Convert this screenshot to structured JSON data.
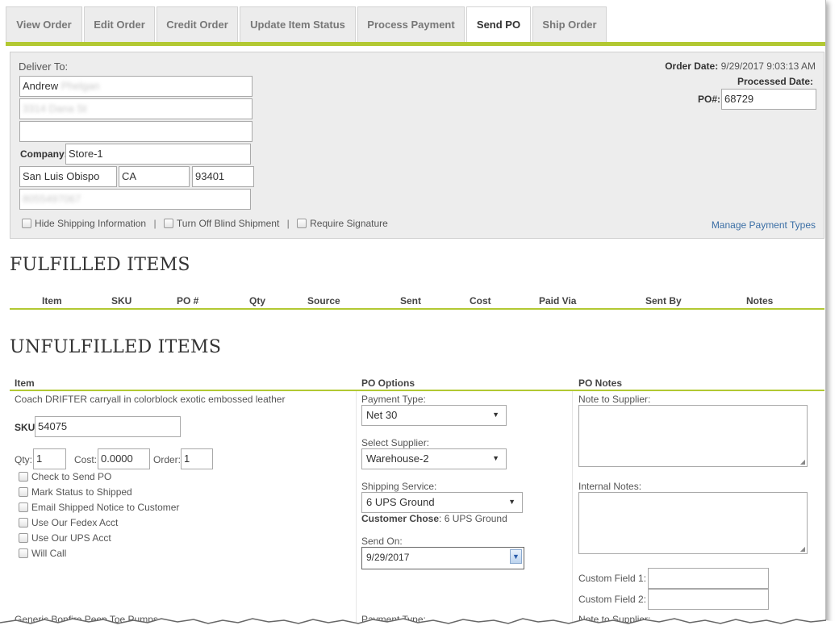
{
  "tabs": [
    {
      "label": "View Order"
    },
    {
      "label": "Edit Order"
    },
    {
      "label": "Credit Order"
    },
    {
      "label": "Update Item Status"
    },
    {
      "label": "Process Payment"
    },
    {
      "label": "Send PO"
    },
    {
      "label": "Ship Order"
    }
  ],
  "deliver": {
    "heading": "Deliver To:",
    "name": "Andrew",
    "name_redacted": "Phelgan",
    "address1_redacted": "3314 Dana St",
    "address2": "",
    "company_label": "Company:",
    "company": "Store-1",
    "city": "San Luis Obispo",
    "state": "CA",
    "zip": "93401",
    "phone_redacted": "8055497067",
    "checkboxes": {
      "hide_shipping": "Hide Shipping Information",
      "blind_shipment": "Turn Off Blind Shipment",
      "require_signature": "Require Signature"
    },
    "separator": "|",
    "order_date_label": "Order Date:",
    "order_date": "9/29/2017 9:03:13 AM",
    "processed_date_label": "Processed Date:",
    "po_label": "PO#:",
    "po_value": "68729",
    "manage_payment_types": "Manage Payment Types"
  },
  "fulfilled": {
    "title": "FULFILLED ITEMS",
    "columns": [
      "Item",
      "SKU",
      "PO #",
      "Qty",
      "Source",
      "Sent",
      "Cost",
      "Paid Via",
      "Sent By",
      "Notes"
    ]
  },
  "unfulfilled": {
    "title": "UNFULFILLED ITEMS",
    "columns": {
      "item": "Item",
      "po_options": "PO Options",
      "po_notes": "PO Notes"
    },
    "item": {
      "description": "Coach DRIFTER carryall in colorblock exotic embossed leather",
      "sku_label": "SKU:",
      "sku": "54075",
      "qty_label": "Qty:",
      "qty": "1",
      "cost_label": "Cost:",
      "cost": "0.0000",
      "order_label": "Order:",
      "order": "1",
      "checkboxes": [
        "Check to Send PO",
        "Mark Status to Shipped",
        "Email Shipped Notice to Customer",
        "Use Our Fedex Acct",
        "Use Our UPS Acct",
        "Will Call"
      ]
    },
    "po_options": {
      "payment_type_label": "Payment Type:",
      "payment_type": "Net 30",
      "supplier_label": "Select Supplier:",
      "supplier": "Warehouse-2",
      "shipping_label": "Shipping Service:",
      "shipping": "6 UPS Ground",
      "customer_chose_label": "Customer Chose",
      "customer_chose": ": 6 UPS Ground",
      "send_on_label": "Send On:",
      "send_on": "9/29/2017"
    },
    "po_notes": {
      "note_to_supplier_label": "Note to Supplier:",
      "internal_notes_label": "Internal Notes:",
      "custom_field_1_label": "Custom Field 1:",
      "custom_field_2_label": "Custom Field 2:"
    },
    "next_item": {
      "description": "Generic Bonfire Peep Toe Pumps",
      "payment_type_label": "Payment Type:",
      "note_to_supplier_label": "Note to Supplier:"
    }
  },
  "colors": {
    "accent": "#b2c832",
    "link": "#3a6ea5",
    "panel": "#ededed"
  }
}
